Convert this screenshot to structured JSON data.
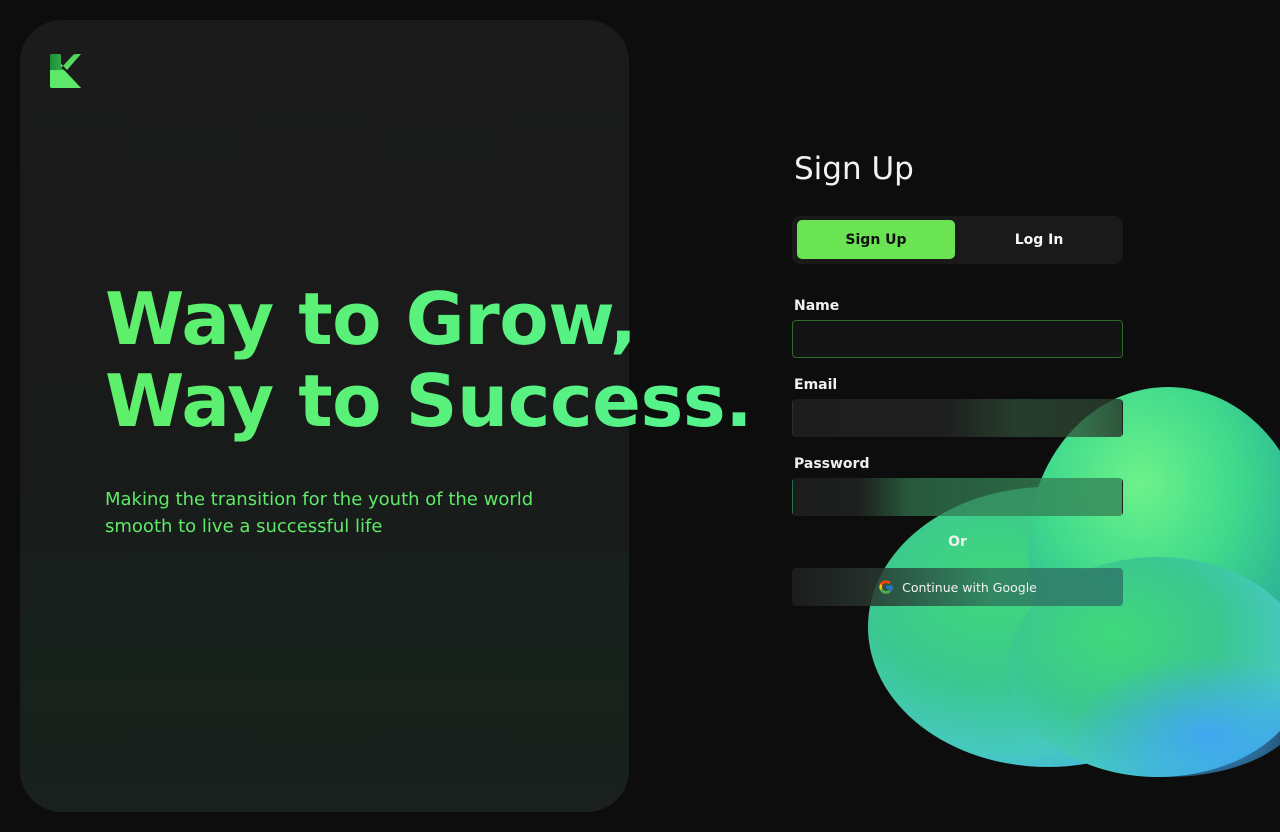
{
  "hero": {
    "headline_line1": "Way to Grow,",
    "headline_line2": "Way to Success.",
    "subline": "Making the transition for the youth of the world smooth to live a successful life"
  },
  "form": {
    "title": "Sign Up",
    "tabs": [
      {
        "label": "Sign Up",
        "active": true
      },
      {
        "label": "Log In",
        "active": false
      }
    ],
    "fields": {
      "name": {
        "label": "Name",
        "value": "",
        "placeholder": ""
      },
      "email": {
        "label": "Email",
        "value": "",
        "placeholder": ""
      },
      "password": {
        "label": "Password",
        "value": "",
        "placeholder": ""
      }
    },
    "divider_text": "Or",
    "google_button_label": "Continue with Google"
  },
  "icons": {
    "logo": "brand-logo-icon",
    "google": "google-icon"
  },
  "colors": {
    "accent": "#6ae453",
    "headline_green": "#5ef06a",
    "background": "#0d0d0d",
    "panel": "#1b1b1b"
  }
}
